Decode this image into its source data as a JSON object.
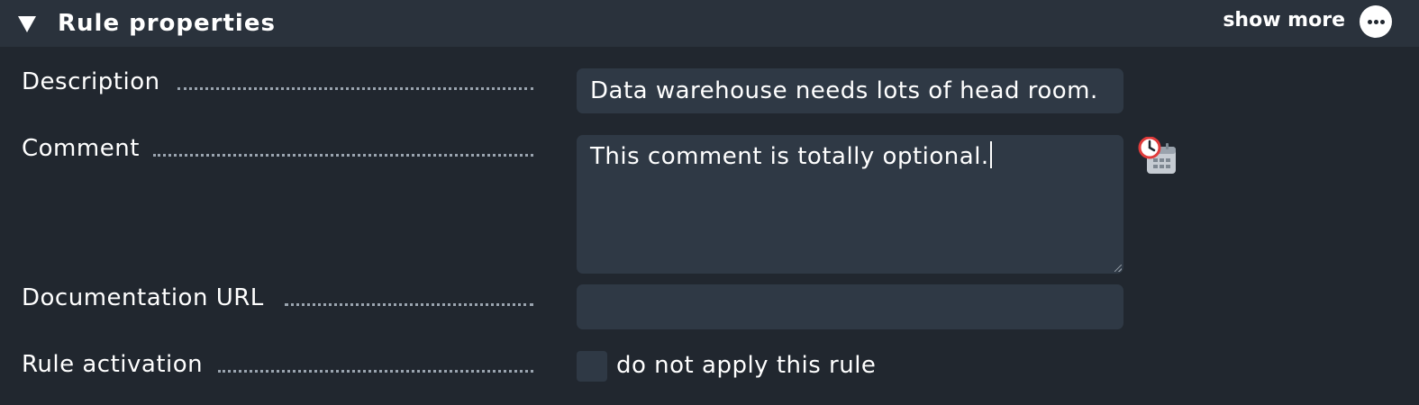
{
  "header": {
    "title": "Rule properties",
    "show_more_label": "show more",
    "collapse_icon": "triangle-down-icon",
    "more_icon": "ellipsis-icon"
  },
  "fields": {
    "description": {
      "label": "Description",
      "value": "Data warehouse needs lots of head room."
    },
    "comment": {
      "label": "Comment",
      "value": "This comment is totally optional.",
      "timestamp_icon": "clock-calendar-icon"
    },
    "documentation_url": {
      "label": "Documentation URL",
      "value": ""
    },
    "rule_activation": {
      "label": "Rule activation",
      "checkbox_label": "do not apply this rule",
      "checked": false
    }
  },
  "colors": {
    "background": "#21272f",
    "header_background": "#2a323c",
    "field_background": "#2f3945",
    "text": "#ffffff",
    "icon_accent": "#e03b3b"
  }
}
